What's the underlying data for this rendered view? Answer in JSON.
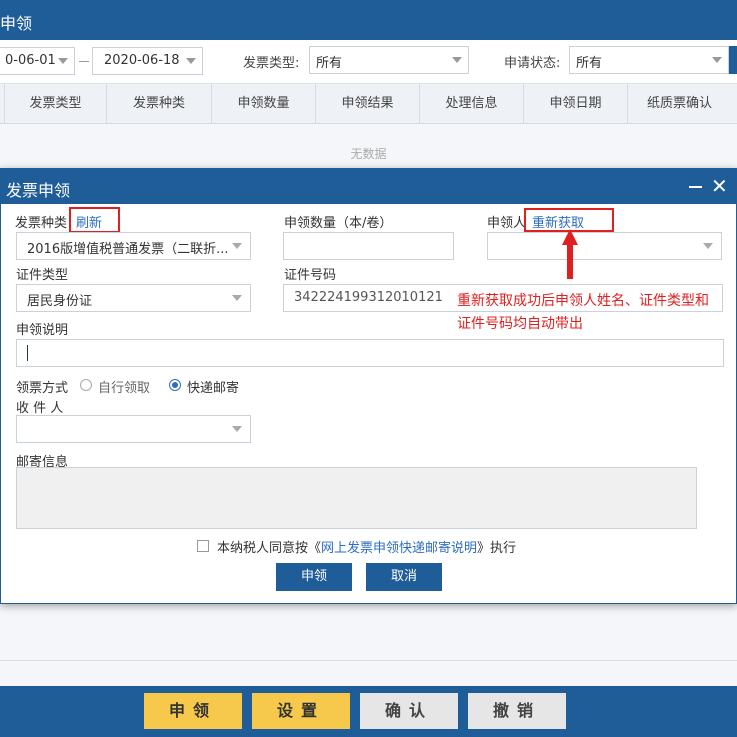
{
  "background": {
    "window_title": "申领",
    "filter": {
      "date_from": "0-06-01",
      "date_to": "2020-06-18",
      "invoice_type_label": "发票类型:",
      "invoice_type_value": "所有",
      "status_label": "申请状态:",
      "status_value": "所有"
    },
    "table_headers": [
      "发票类型",
      "发票种类",
      "申领数量",
      "申领结果",
      "处理信息",
      "申领日期",
      "纸质票确认"
    ],
    "empty_text": "无数据",
    "bottom_buttons": {
      "apply": "申领",
      "settings": "设置",
      "confirm": "确认",
      "cancel": "撤销"
    }
  },
  "dialog": {
    "title": "发票申领",
    "invoice_kind_label": "发票种类",
    "refresh_link": "刷新",
    "invoice_kind_value": "2016版增值税普通发票（二联折...",
    "quantity_label": "申领数量（本/卷）",
    "quantity_value": "",
    "applicant_label": "申领人",
    "reacquire_link": "重新获取",
    "applicant_value": "",
    "id_type_label": "证件类型",
    "id_type_value": "居民身份证",
    "id_number_label": "证件号码",
    "id_number_value": "342224199312010121",
    "annotation": [
      "重新获取成功后申领人姓名、证件类型和",
      "证件号码均自动带出"
    ],
    "description_label": "申领说明",
    "description_value": "",
    "pickup_method_label": "领票方式",
    "pickup_self": "自行领取",
    "pickup_mail": "快递邮寄",
    "pickup_selected": "快递邮寄",
    "recipient_label": "收 件 人",
    "recipient_value": "",
    "mail_info_label": "邮寄信息",
    "agree_prefix": "本纳税人同意按《",
    "agree_link": "网上发票申领快递邮寄说明",
    "agree_suffix": "》执行",
    "submit_label": "申领",
    "cancel_label": "取消"
  },
  "colors": {
    "primary": "#1f5d99",
    "annotation_red": "#e02020",
    "link_blue": "#2b6cc4",
    "bottom_button_yellow": "#f6c84c"
  },
  "icons": [
    "dropdown-arrow-icon",
    "minimize-icon",
    "close-icon",
    "red-arrow-icon"
  ]
}
